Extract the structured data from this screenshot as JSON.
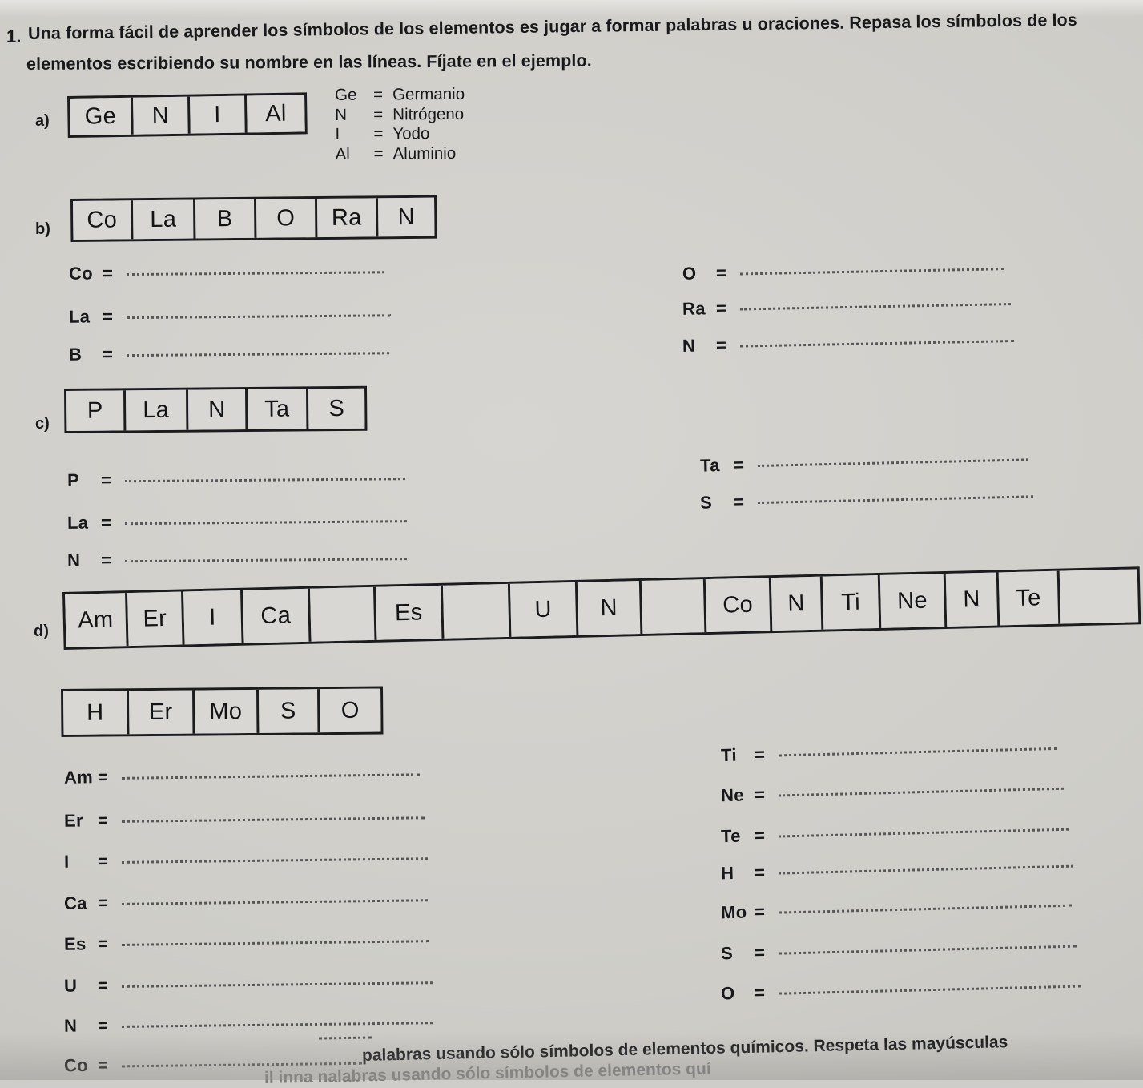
{
  "page": {
    "background_color": "#cecdc8",
    "ink_color": "#17181a",
    "question_number": "1.",
    "question_line_1": "Una forma fácil de aprender los símbolos de los elementos es jugar a formar palabras u oraciones. Repasa los símbolos de los",
    "question_line_2": "elementos escribiendo su nombre en las líneas. Fíjate en el ejemplo.",
    "bottom_note": "palabras usando sólo símbolos de elementos químicos. Respeta las mayúsculas",
    "bottom_note_faded": "il    inna nalabras usando sólo símbolos de elementos quí"
  },
  "sections": [
    {
      "letter": "a)",
      "word": "GENIAL",
      "cells": [
        "Ge",
        "N",
        "I",
        "Al"
      ],
      "legend": [
        {
          "symbol": "Ge",
          "equals": "=",
          "name": "Germanio"
        },
        {
          "symbol": "N",
          "equals": "=",
          "name": "Nitrógeno"
        },
        {
          "symbol": "I",
          "equals": "=",
          "name": "Yodo"
        },
        {
          "symbol": "Al",
          "equals": "=",
          "name": "Aluminio"
        }
      ]
    },
    {
      "letter": "b)",
      "word": "COLABORAN",
      "cells": [
        "Co",
        "La",
        "B",
        "O",
        "Ra",
        "N"
      ],
      "answers_left": [
        {
          "symbol": "Co",
          "equals": "=",
          "value": ""
        },
        {
          "symbol": "La",
          "equals": "=",
          "value": ""
        },
        {
          "symbol": "B",
          "equals": "=",
          "value": ""
        }
      ],
      "answers_right": [
        {
          "symbol": "O",
          "equals": "=",
          "value": ""
        },
        {
          "symbol": "Ra",
          "equals": "=",
          "value": ""
        },
        {
          "symbol": "N",
          "equals": "=",
          "value": ""
        }
      ]
    },
    {
      "letter": "c)",
      "word": "PLANTAS",
      "cells": [
        "P",
        "La",
        "N",
        "Ta",
        "S"
      ],
      "answers_left": [
        {
          "symbol": "P",
          "equals": "=",
          "value": ""
        },
        {
          "symbol": "La",
          "equals": "=",
          "value": ""
        },
        {
          "symbol": "N",
          "equals": "=",
          "value": ""
        }
      ],
      "answers_right": [
        {
          "symbol": "Ta",
          "equals": "=",
          "value": ""
        },
        {
          "symbol": "S",
          "equals": "=",
          "value": ""
        }
      ]
    },
    {
      "letter": "d)",
      "word": "AMERICA ES UN CONTINENTE",
      "cells": [
        "Am",
        "Er",
        "I",
        "Ca",
        "",
        "Es",
        "",
        "U",
        "N",
        "",
        "Co",
        "N",
        "Ti",
        "Ne",
        "N",
        "Te",
        ""
      ],
      "cells2": [
        "H",
        "Er",
        "Mo",
        "S",
        "O"
      ],
      "word2": "HERMOSO",
      "answers_left": [
        {
          "symbol": "Am",
          "equals": "=",
          "value": ""
        },
        {
          "symbol": "Er",
          "equals": "=",
          "value": ""
        },
        {
          "symbol": "I",
          "equals": "=",
          "value": ""
        },
        {
          "symbol": "Ca",
          "equals": "=",
          "value": ""
        },
        {
          "symbol": "Es",
          "equals": "=",
          "value": ""
        },
        {
          "symbol": "U",
          "equals": "=",
          "value": ""
        },
        {
          "symbol": "N",
          "equals": "=",
          "value": ""
        },
        {
          "symbol": "Co",
          "equals": "=",
          "value": ""
        }
      ],
      "answers_right": [
        {
          "symbol": "Ti",
          "equals": "=",
          "value": ""
        },
        {
          "symbol": "Ne",
          "equals": "=",
          "value": ""
        },
        {
          "symbol": "Te",
          "equals": "=",
          "value": ""
        },
        {
          "symbol": "H",
          "equals": "=",
          "value": ""
        },
        {
          "symbol": "Mo",
          "equals": "=",
          "value": ""
        },
        {
          "symbol": "S",
          "equals": "=",
          "value": ""
        },
        {
          "symbol": "O",
          "equals": "=",
          "value": ""
        }
      ]
    }
  ]
}
